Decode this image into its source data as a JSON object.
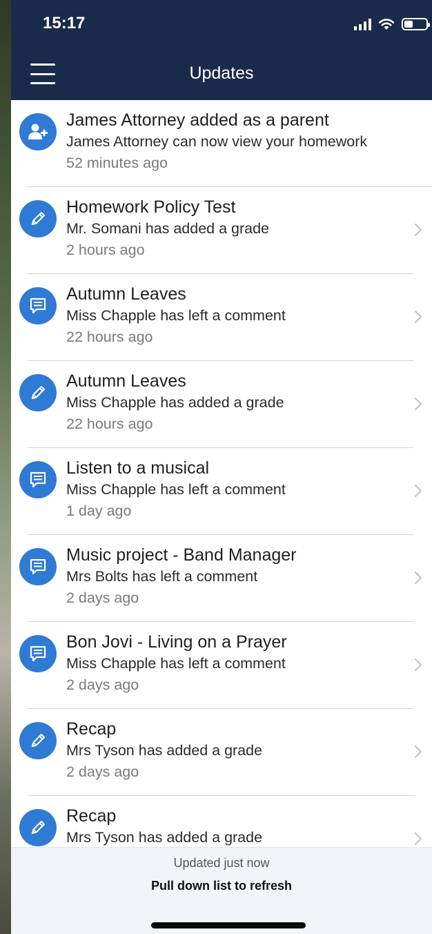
{
  "status_bar": {
    "time": "15:17",
    "icons": [
      "signal-icon",
      "wifi-icon",
      "battery-icon"
    ]
  },
  "header": {
    "menu_icon": "hamburger-menu-icon",
    "title": "Updates",
    "bg_color": "#1a2a4a"
  },
  "accent_color": "#2f7ad4",
  "updates": [
    {
      "icon": "add-user-icon",
      "title": "James Attorney added as a parent",
      "subtitle": "James Attorney can now view your homework",
      "time": "52 minutes ago",
      "has_chevron": false
    },
    {
      "icon": "pencil-icon",
      "title": "Homework Policy Test",
      "subtitle": "Mr. Somani has added a grade",
      "time": "2 hours ago",
      "has_chevron": true
    },
    {
      "icon": "comment-icon",
      "title": "Autumn Leaves",
      "subtitle": "Miss Chapple has left a comment",
      "time": "22 hours ago",
      "has_chevron": true
    },
    {
      "icon": "pencil-icon",
      "title": "Autumn Leaves",
      "subtitle": "Miss Chapple has added a grade",
      "time": "22 hours ago",
      "has_chevron": true
    },
    {
      "icon": "comment-icon",
      "title": "Listen to a musical",
      "subtitle": "Miss Chapple has left a comment",
      "time": "1 day ago",
      "has_chevron": true
    },
    {
      "icon": "comment-icon",
      "title": "Music project - Band Manager",
      "subtitle": "Mrs Bolts has left a comment",
      "time": "2 days ago",
      "has_chevron": true
    },
    {
      "icon": "comment-icon",
      "title": "Bon Jovi - Living on a Prayer",
      "subtitle": "Miss Chapple has left a comment",
      "time": "2 days ago",
      "has_chevron": true
    },
    {
      "icon": "pencil-icon",
      "title": "Recap",
      "subtitle": "Mrs Tyson has added a grade",
      "time": "2 days ago",
      "has_chevron": true
    },
    {
      "icon": "pencil-icon",
      "title": "Recap",
      "subtitle": "Mrs Tyson has added a grade",
      "time": "",
      "has_chevron": true
    }
  ],
  "footer": {
    "status": "Updated just now",
    "hint": "Pull down list to refresh"
  }
}
